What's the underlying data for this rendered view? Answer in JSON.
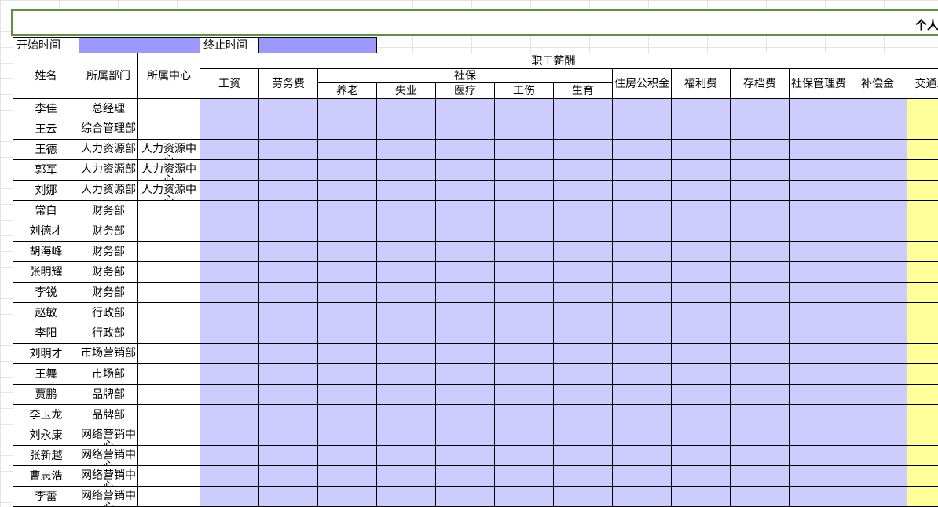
{
  "title_partial": "个人",
  "meta": {
    "start_label": "开始时间",
    "end_label": "终止时间",
    "start_value": "",
    "end_value": ""
  },
  "headers": {
    "name": "姓名",
    "dept": "所属部门",
    "center": "所属中心",
    "salary_group": "职工薪酬",
    "wage": "工资",
    "labor": "劳务费",
    "social_group": "社保",
    "pension": "养老",
    "unemployment": "失业",
    "medical": "医疗",
    "injury": "工伤",
    "maternity": "生育",
    "housing": "住房公积金",
    "welfare": "福利费",
    "archive": "存档费",
    "social_mgmt": "社保管理费",
    "compensation": "补偿金",
    "transport": "交通工费"
  },
  "rows": [
    {
      "name": "李佳",
      "dept": "总经理",
      "center": ""
    },
    {
      "name": "王云",
      "dept": "综合管理部",
      "center": ""
    },
    {
      "name": "王德",
      "dept": "人力资源部",
      "center": "人力资源中心"
    },
    {
      "name": "郭军",
      "dept": "人力资源部",
      "center": "人力资源中心"
    },
    {
      "name": "刘娜",
      "dept": "人力资源部",
      "center": "人力资源中心"
    },
    {
      "name": "常白",
      "dept": "财务部",
      "center": ""
    },
    {
      "name": "刘德才",
      "dept": "财务部",
      "center": ""
    },
    {
      "name": "胡海峰",
      "dept": "财务部",
      "center": ""
    },
    {
      "name": "张明耀",
      "dept": "财务部",
      "center": ""
    },
    {
      "name": "李锐",
      "dept": "财务部",
      "center": ""
    },
    {
      "name": "赵敏",
      "dept": "行政部",
      "center": ""
    },
    {
      "name": "李阳",
      "dept": "行政部",
      "center": ""
    },
    {
      "name": "刘明才",
      "dept": "市场营销部",
      "center": ""
    },
    {
      "name": "王舞",
      "dept": "市场部",
      "center": ""
    },
    {
      "name": "贾鹏",
      "dept": "品牌部",
      "center": ""
    },
    {
      "name": "李玉龙",
      "dept": "品牌部",
      "center": ""
    },
    {
      "name": "刘永康",
      "dept": "网络营销中心",
      "center": ""
    },
    {
      "name": "张新越",
      "dept": "网络营销中心",
      "center": ""
    },
    {
      "name": "曹志浩",
      "dept": "网络营销中心",
      "center": ""
    },
    {
      "name": "李蕾",
      "dept": "网络营销中心",
      "center": ""
    }
  ],
  "colors": {
    "title_border": "#5f913f",
    "data_fill": "#ccccff",
    "date_fill": "#9999ff",
    "transport_fill": "#ffff99"
  }
}
